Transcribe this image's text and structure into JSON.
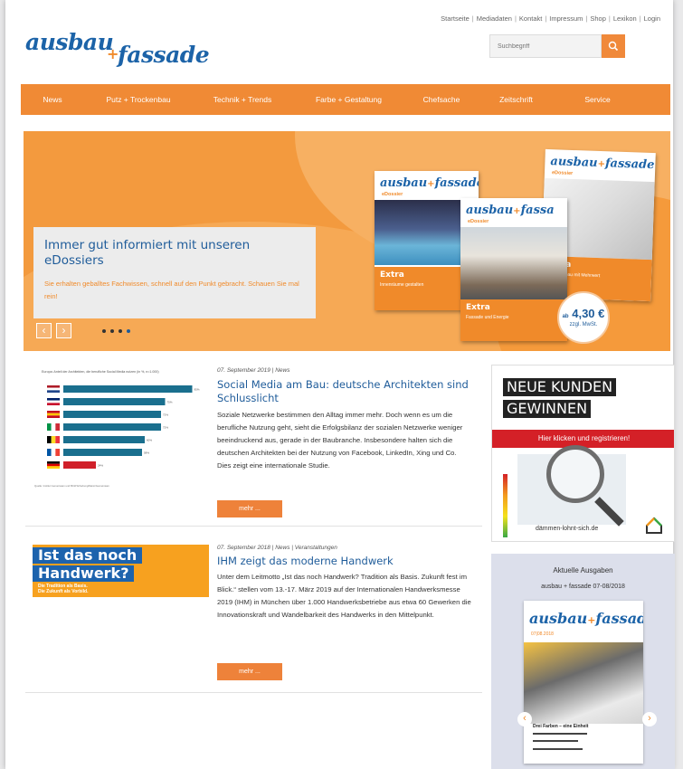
{
  "toplinks": [
    "Startseite",
    "Mediadaten",
    "Kontakt",
    "Impressum",
    "Shop",
    "Lexikon",
    "Login"
  ],
  "logo": {
    "word1": "ausbau",
    "plus": "+",
    "word2": "fassade"
  },
  "search": {
    "placeholder": "Suchbegriff"
  },
  "nav": [
    "News",
    "Putz + Trockenbau",
    "Technik + Trends",
    "Farbe + Gestaltung",
    "Chefsache",
    "Zeitschrift",
    "Service"
  ],
  "hero": {
    "title": "Immer gut informiert mit unseren eDossiers",
    "text": "Sie erhalten geballtes Fachwissen, schnell auf den Punkt gebracht. Schauen Sie mal rein!",
    "prev": "‹",
    "next": "›",
    "slides_total": 4,
    "slide_active": 4,
    "mags": [
      {
        "logo": "ausbau",
        "logo2": "fassade",
        "sub": "eDossier",
        "extra": "Extra",
        "topic": "Innenräume gestalten"
      },
      {
        "logo": "ausbau",
        "logo2": "fassa",
        "sub": "eDossier",
        "extra": "Extra",
        "topic": "Fassade und Energie"
      },
      {
        "logo": "ausbau",
        "logo2": "fassade",
        "sub": "eDossier",
        "extra": "Extra",
        "topic": "Innenausbau mit Mehrwert"
      }
    ],
    "price": {
      "prefix": "ab",
      "value": "4,30 €",
      "note": "zzgl. MwSt."
    }
  },
  "articles": [
    {
      "meta": "07. September 2019 | News",
      "title": "Social Media am Bau: deutsche Architekten sind Schlusslicht",
      "body": "Soziale Netzwerke bestimmen den Alltag immer mehr. Doch wenn es um die berufliche Nutzung geht, sieht die Erfolgsbilanz der sozialen Netzwerke weniger beeindruckend aus, gerade in der Baubranche. Insbesondere halten sich die deutschen Architekten bei der Nutzung von Facebook, LinkedIn, Xing und Co. Dies zeigt eine internationale Studie.",
      "more": "mehr ..."
    },
    {
      "meta": "07. September 2018 | News | Veranstaltungen",
      "title": "IHM zeigt das moderne Handwerk",
      "body": "Unter dem Leitmotto „Ist das noch Handwerk? Tradition als Basis. Zukunft fest im Blick.“ stellen vom 13.-17. März 2019 auf der Internationalen Handwerksmesse 2019 (IHM) in München über 1.000 Handwerksbetriebe aus etwa 60 Gewerken die Innovationskraft und Wandelbarkeit des Handwerks in den Mittelpunkt.",
      "more": "mehr ..."
    }
  ],
  "chart_data": {
    "type": "bar",
    "title": "Europa: Anteil der Architekten, die berufliche Social Media nutzen (in %, n=1.000)",
    "categories": [
      "NL",
      "UK",
      "ES",
      "IT",
      "BE",
      "FR",
      "DE"
    ],
    "values": [
      95,
      75,
      72,
      72,
      60,
      58,
      24
    ],
    "xlim": [
      0,
      100
    ],
    "bar_colors": [
      "#1a6f8e",
      "#1a6f8e",
      "#1a6f8e",
      "#1a6f8e",
      "#1a6f8e",
      "#1a6f8e",
      "#d0202a"
    ],
    "source": "Quelle: Institut Gemeinsam und BCW Erhebung/Mann/Gemeinsam"
  },
  "handwerk_banner": {
    "line1": "Ist das noch",
    "line2": "Handwerk?",
    "line3": "Die Tradition als Basis.",
    "line4": "Die Zukunft als Vorbild."
  },
  "ad1": {
    "line1": "NEUE KUNDEN",
    "line2": "GEWINNEN",
    "cta": "Hier klicken und registrieren!",
    "url": "dämmen-lohnt-sich.de"
  },
  "ad2": {
    "title": "Aktuelle Ausgaben",
    "subtitle": "ausbau + fassade 07-08/2018",
    "cover_logo1": "ausbau",
    "cover_logo2": "fassade",
    "cover_date": "07|08.2018",
    "cover_headline": "Drei Farben – eine Einheit",
    "prev": "‹",
    "next": "›"
  },
  "colors": {
    "brand_blue": "#1c63a8",
    "brand_orange": "#f08a35"
  }
}
